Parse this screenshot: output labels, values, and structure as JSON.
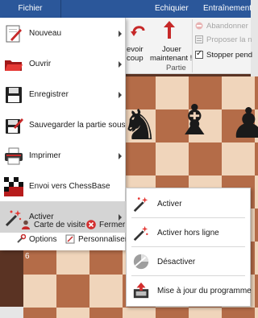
{
  "ribbon": {
    "tabs": {
      "file": "Fichier",
      "board": "Echiquier",
      "training": "Entraînement"
    },
    "buttons": {
      "fragment1_line1": "evoir",
      "fragment1_line2": "coup",
      "play_now_line1": "Jouer",
      "play_now_line2": "maintenant !",
      "resign": "Abandonner",
      "offer_draw": "Proposer la n",
      "stop_pend": "Stopper pend"
    },
    "group_label": "Partie"
  },
  "board": {
    "rank_label": "6"
  },
  "file_menu": {
    "items": [
      {
        "label": "Nouveau",
        "icon": "new-document-icon",
        "has_submenu": true
      },
      {
        "label": "Ouvrir",
        "icon": "open-folder-icon",
        "has_submenu": true
      },
      {
        "label": "Enregistrer",
        "icon": "save-disk-icon",
        "has_submenu": true
      },
      {
        "label": "Sauvegarder la partie sous",
        "icon": "save-game-as-icon",
        "has_submenu": false
      },
      {
        "label": "Imprimer",
        "icon": "printer-icon",
        "has_submenu": true
      },
      {
        "label": "Envoi vers ChessBase",
        "icon": "chessbase-icon",
        "has_submenu": false
      },
      {
        "label": "Activer",
        "icon": "activate-wand-icon",
        "has_submenu": true,
        "active": true
      }
    ],
    "footer": {
      "business_card": "Carte de visite",
      "close": "Fermer",
      "options": "Options",
      "customize": "Personnaliser"
    }
  },
  "activate_submenu": {
    "items": [
      {
        "label": "Activer",
        "icon": "activate-wand-icon"
      },
      {
        "label": "Activer hors ligne",
        "icon": "activate-offline-icon"
      },
      {
        "label": "Désactiver",
        "icon": "deactivate-icon"
      },
      {
        "label": "Mise à jour du programme",
        "icon": "update-program-icon"
      }
    ]
  },
  "colors": {
    "accent": "#2b579a",
    "active_item": "#d4d4d4",
    "board_dark": "#b46c48",
    "board_light": "#f0d5bb"
  }
}
